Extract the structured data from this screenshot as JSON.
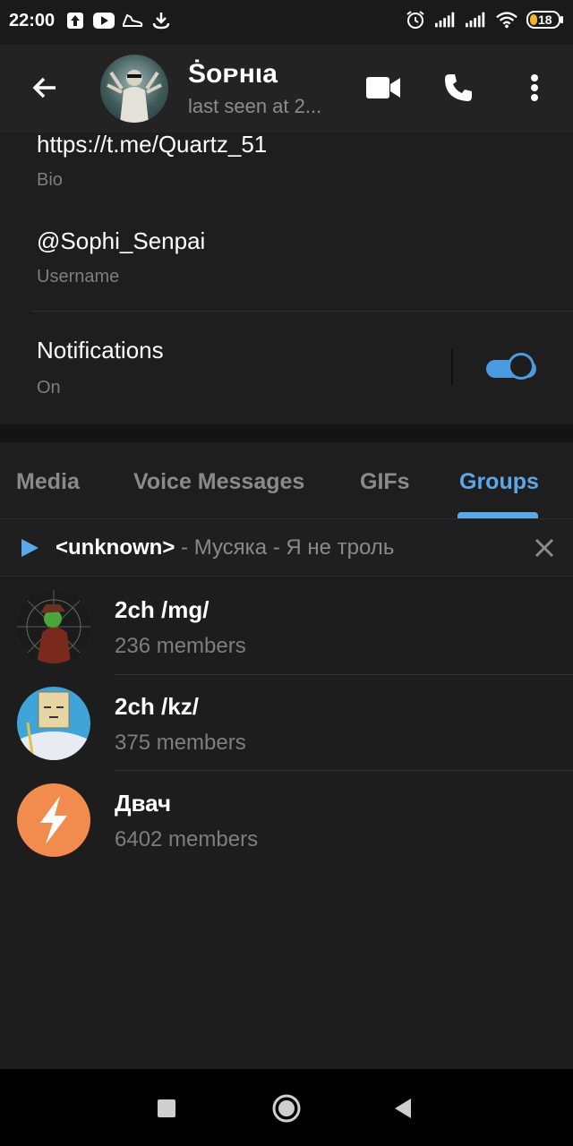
{
  "status_bar": {
    "time": "22:00",
    "battery": "18",
    "icons_left": [
      "upload-icon",
      "youtube-icon",
      "shoe-icon",
      "download-icon"
    ],
    "icons_right": [
      "alarm-icon",
      "signal-icon",
      "signal-icon",
      "wifi-icon",
      "battery-icon"
    ]
  },
  "header": {
    "name": "Ṡᴏᴘнιa",
    "status": "last seen at 2..."
  },
  "info": {
    "bio_value": "https://t.me/Quartz_51",
    "bio_label": "Bio",
    "username_value": "@Sophi_Senpai",
    "username_label": "Username",
    "notifications_title": "Notifications",
    "notifications_state": "On",
    "notifications_enabled": true
  },
  "tabs": [
    {
      "label": "Media",
      "active": false
    },
    {
      "label": "Voice Messages",
      "active": false
    },
    {
      "label": "GIFs",
      "active": false
    },
    {
      "label": "Groups",
      "active": true
    }
  ],
  "player": {
    "title": "<unknown>",
    "rest": " - Мусяка - Я не троль"
  },
  "groups": [
    {
      "name": "2ch /mg/",
      "members": "236 members"
    },
    {
      "name": "2ch /kz/",
      "members": "375 members"
    },
    {
      "name": "Двач",
      "members": "6402 members"
    }
  ],
  "colors": {
    "accent": "#5aa7ea",
    "background": "#1d1d1d",
    "header": "#232323",
    "dvach_orange": "#f28c4e"
  }
}
